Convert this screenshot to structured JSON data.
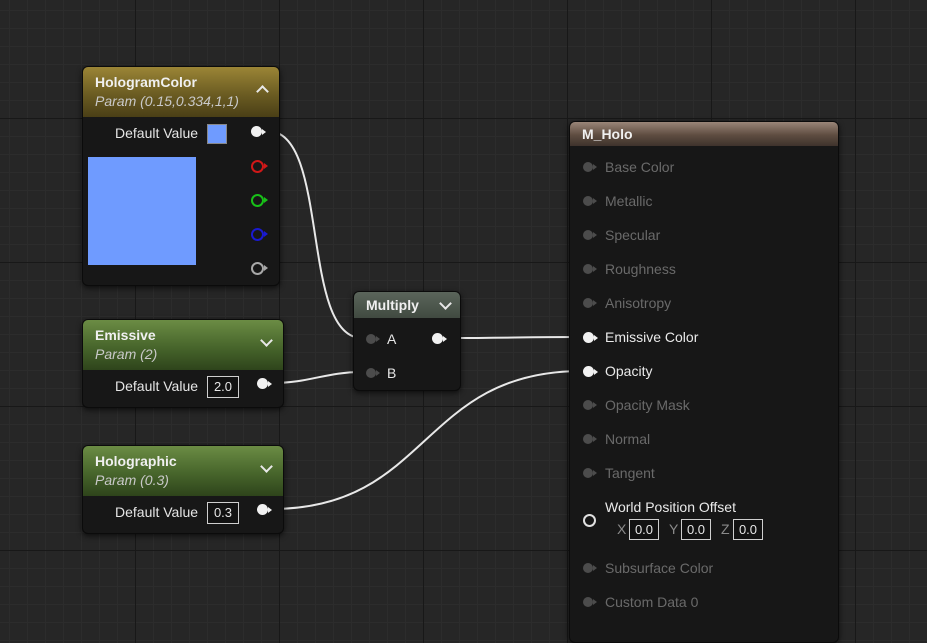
{
  "nodes": {
    "hologram_color": {
      "title": "HologramColor",
      "subtitle": "Param (0.15,0.334,1,1)",
      "default_label": "Default Value",
      "swatch_color": "#6f9bff"
    },
    "emissive": {
      "title": "Emissive",
      "subtitle": "Param (2)",
      "default_label": "Default Value",
      "value": "2.0"
    },
    "holographic": {
      "title": "Holographic",
      "subtitle": "Param (0.3)",
      "default_label": "Default Value",
      "value": "0.3"
    },
    "multiply": {
      "title": "Multiply",
      "input_a": "A",
      "input_b": "B"
    },
    "material": {
      "title": "M_Holo",
      "pins": [
        {
          "label": "Base Color",
          "active": false
        },
        {
          "label": "Metallic",
          "active": false
        },
        {
          "label": "Specular",
          "active": false
        },
        {
          "label": "Roughness",
          "active": false
        },
        {
          "label": "Anisotropy",
          "active": false
        },
        {
          "label": "Emissive Color",
          "active": true
        },
        {
          "label": "Opacity",
          "active": true
        },
        {
          "label": "Opacity Mask",
          "active": false
        },
        {
          "label": "Normal",
          "active": false
        },
        {
          "label": "Tangent",
          "active": false
        },
        {
          "label": "World Position Offset",
          "active": true
        },
        {
          "label": "Subsurface Color",
          "active": false
        },
        {
          "label": "Custom Data 0",
          "active": false
        }
      ],
      "wpo": {
        "x_label": "X",
        "x_value": "0.0",
        "y_label": "Y",
        "y_value": "0.0",
        "z_label": "Z",
        "z_value": "0.0"
      }
    }
  },
  "channel_pins": [
    {
      "name": "red-channel-pin-icon",
      "color": "#d01818"
    },
    {
      "name": "green-channel-pin-icon",
      "color": "#18c018"
    },
    {
      "name": "blue-channel-pin-icon",
      "color": "#1a1ad0"
    },
    {
      "name": "alpha-channel-pin-icon",
      "color": "#a8a8a8"
    }
  ]
}
